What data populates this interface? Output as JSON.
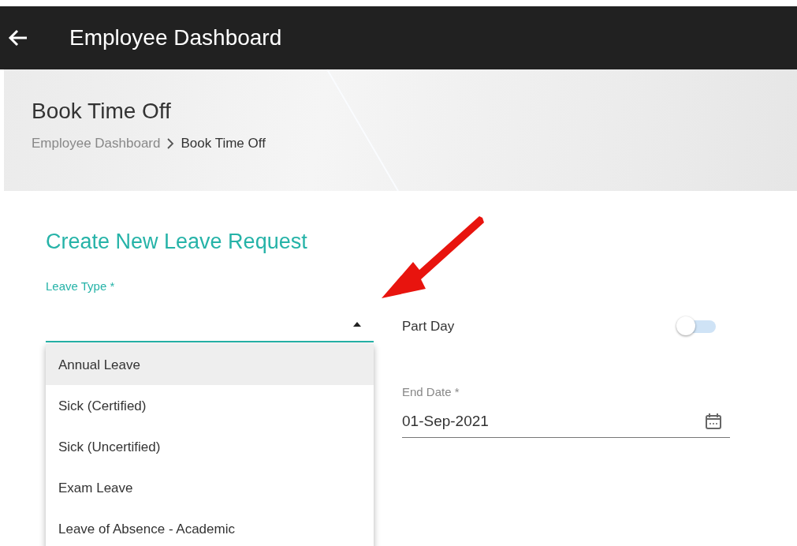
{
  "app_bar": {
    "title": "Employee Dashboard"
  },
  "page_header": {
    "title": "Book Time Off",
    "breadcrumb": [
      {
        "label": "Employee Dashboard",
        "current": false
      },
      {
        "label": "Book Time Off",
        "current": true
      }
    ]
  },
  "form": {
    "title": "Create New Leave Request",
    "leave_type": {
      "label": "Leave Type *",
      "expanded": true,
      "options": [
        {
          "label": "Annual Leave",
          "selected": true
        },
        {
          "label": "Sick (Certified)",
          "selected": false
        },
        {
          "label": "Sick (Uncertified)",
          "selected": false
        },
        {
          "label": "Exam Leave",
          "selected": false
        },
        {
          "label": "Leave of Absence - Academic",
          "selected": false
        }
      ]
    },
    "part_day": {
      "label": "Part Day",
      "on": false
    },
    "end_date": {
      "label": "End Date *",
      "value": "01-Sep-2021"
    }
  }
}
